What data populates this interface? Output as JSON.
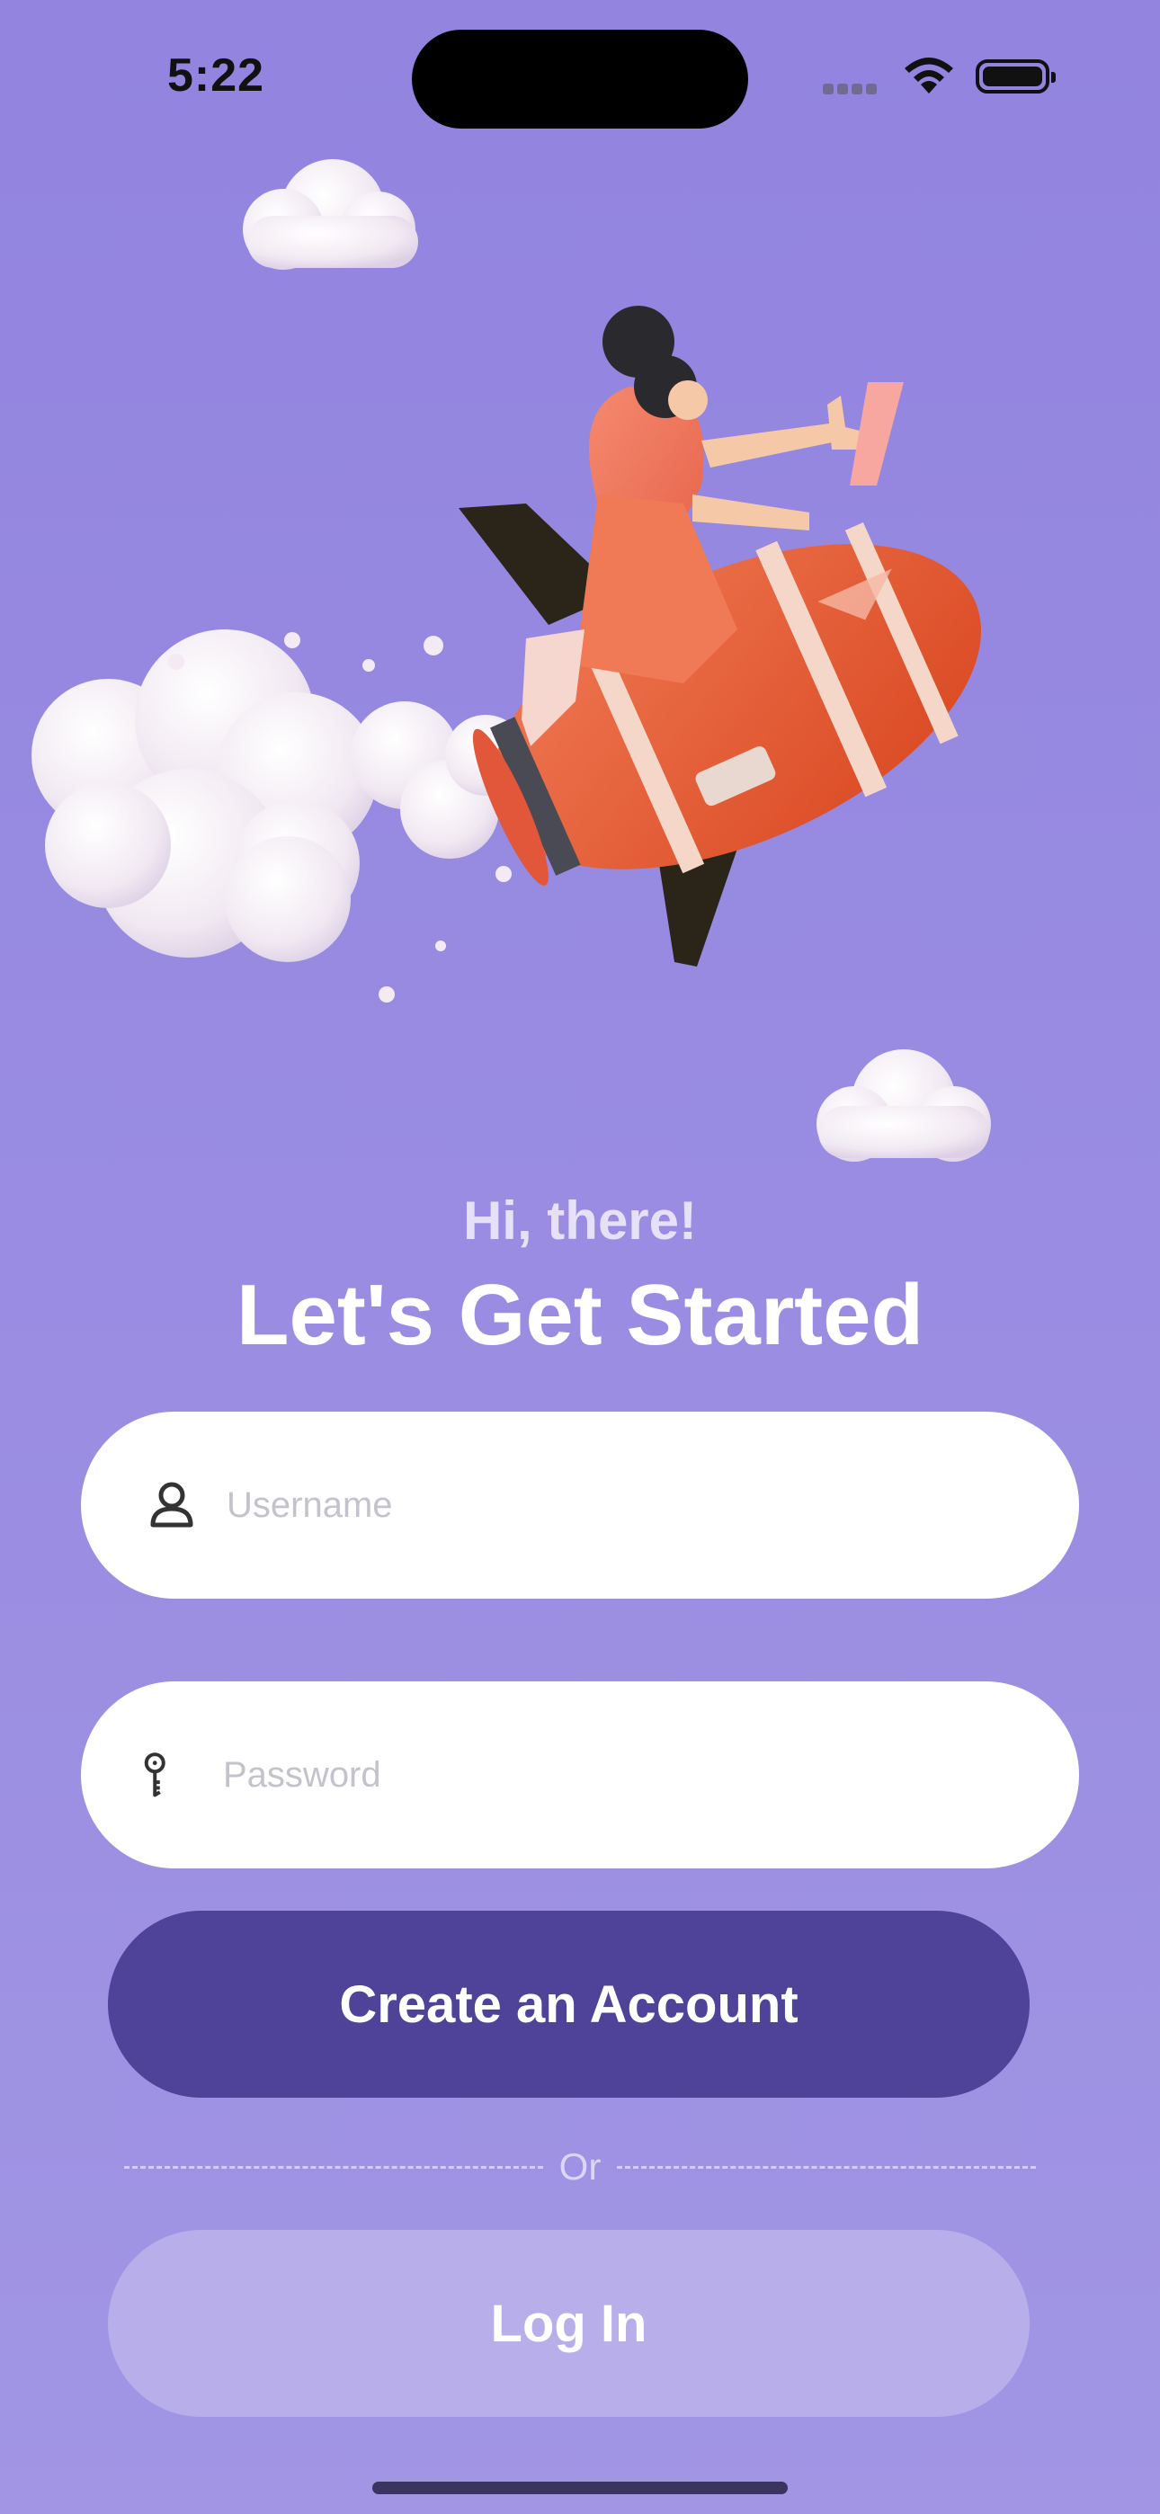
{
  "status_bar": {
    "time": "5:22",
    "wifi_icon": "wifi-icon",
    "battery_icon": "battery-icon"
  },
  "hero": {
    "illustration": "rocket-rider-illustration"
  },
  "greeting": "Hi, there!",
  "title": "Let's Get Started",
  "form": {
    "username": {
      "placeholder": "Username",
      "value": "",
      "icon": "user-icon"
    },
    "password": {
      "placeholder": "Password",
      "value": "",
      "icon": "key-icon"
    }
  },
  "buttons": {
    "create_account": "Create an Account",
    "login": "Log In"
  },
  "divider_text": "Or",
  "colors": {
    "background": "#9a8de2",
    "primary_button": "#4f4299",
    "secondary_button": "#b7aeea",
    "field_background": "#ffffff"
  }
}
